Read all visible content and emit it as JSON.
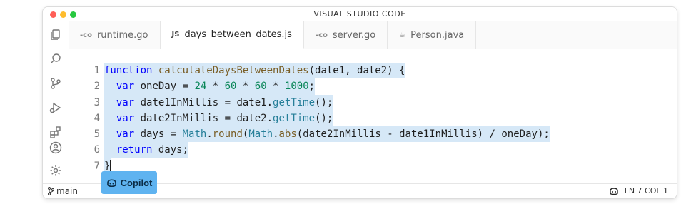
{
  "window": {
    "title": "VISUAL STUDIO CODE",
    "traffic_lights": [
      "#ff5f57",
      "#febc2e",
      "#28c840"
    ]
  },
  "tabs": [
    {
      "icon": "go-icon",
      "glyph": "-co",
      "label": "runtime.go",
      "active": false
    },
    {
      "icon": "js-icon",
      "glyph": "JS",
      "label": "days_between_dates.js",
      "active": true
    },
    {
      "icon": "go-icon",
      "glyph": "-co",
      "label": "server.go",
      "active": false
    },
    {
      "icon": "java-icon",
      "glyph": "☕",
      "label": "Person.java",
      "active": false
    }
  ],
  "activity_bar": [
    "files-icon",
    "search-icon",
    "source-control-icon",
    "run-debug-icon",
    "extensions-icon",
    "account-icon",
    "settings-gear-icon"
  ],
  "editor": {
    "line_numbers": [
      "1",
      "2",
      "3",
      "4",
      "5",
      "6",
      "7"
    ],
    "lines": [
      [
        {
          "t": "function",
          "c": "kw"
        },
        {
          "t": " ",
          "c": "plain"
        },
        {
          "t": "calculateDaysBetweenDates",
          "c": "fn"
        },
        {
          "t": "(date1, date2) {",
          "c": "plain"
        }
      ],
      [
        {
          "t": "  ",
          "c": "plain"
        },
        {
          "t": "var",
          "c": "kw"
        },
        {
          "t": " oneDay = ",
          "c": "plain"
        },
        {
          "t": "24",
          "c": "num"
        },
        {
          "t": " * ",
          "c": "plain"
        },
        {
          "t": "60",
          "c": "num"
        },
        {
          "t": " * ",
          "c": "plain"
        },
        {
          "t": "60",
          "c": "num"
        },
        {
          "t": " * ",
          "c": "plain"
        },
        {
          "t": "1000",
          "c": "num"
        },
        {
          "t": ";",
          "c": "plain"
        }
      ],
      [
        {
          "t": "  ",
          "c": "plain"
        },
        {
          "t": "var",
          "c": "kw"
        },
        {
          "t": " date1InMillis = date1.",
          "c": "plain"
        },
        {
          "t": "getTime",
          "c": "mth"
        },
        {
          "t": "();",
          "c": "plain"
        }
      ],
      [
        {
          "t": "  ",
          "c": "plain"
        },
        {
          "t": "var",
          "c": "kw"
        },
        {
          "t": " date2InMillis = date2.",
          "c": "plain"
        },
        {
          "t": "getTime",
          "c": "mth"
        },
        {
          "t": "();",
          "c": "plain"
        }
      ],
      [
        {
          "t": "  ",
          "c": "plain"
        },
        {
          "t": "var",
          "c": "kw"
        },
        {
          "t": " days = ",
          "c": "plain"
        },
        {
          "t": "Math",
          "c": "mth"
        },
        {
          "t": ".",
          "c": "plain"
        },
        {
          "t": "round",
          "c": "fn"
        },
        {
          "t": "(",
          "c": "plain"
        },
        {
          "t": "Math",
          "c": "mth"
        },
        {
          "t": ".",
          "c": "plain"
        },
        {
          "t": "abs",
          "c": "fn"
        },
        {
          "t": "(date2InMillis - date1InMillis) / oneDay);",
          "c": "plain"
        }
      ],
      [
        {
          "t": "  ",
          "c": "plain"
        },
        {
          "t": "return",
          "c": "kw"
        },
        {
          "t": " days;",
          "c": "plain"
        }
      ],
      [
        {
          "t": "}",
          "c": "plain"
        }
      ]
    ],
    "highlight_color": "#d6e8f7"
  },
  "status": {
    "branch": "main",
    "position": "LN 7 COL 1"
  },
  "copilot_button": {
    "label": "Copilot",
    "color": "#5fb3f0"
  }
}
